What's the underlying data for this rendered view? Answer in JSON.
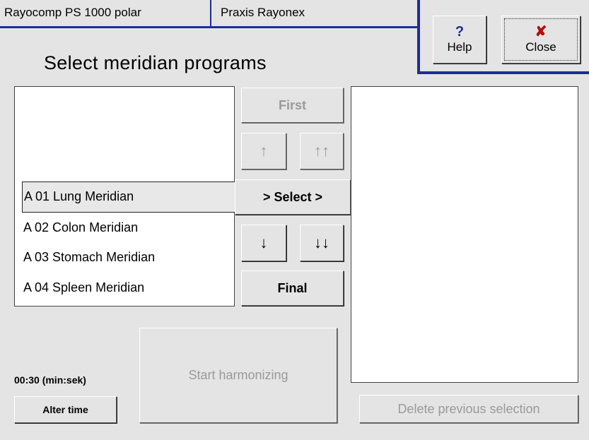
{
  "header": {
    "device_name": "Rayocomp PS 1000 polar",
    "practice_name": "Praxis Rayonex",
    "help_label": "Help",
    "close_label": "Close"
  },
  "page_title": "Select meridian programs",
  "left_list": {
    "items": [
      {
        "label": "A 01 Lung Meridian",
        "selected": true
      },
      {
        "label": "A 02 Colon Meridian",
        "selected": false
      },
      {
        "label": "A 03 Stomach Meridian",
        "selected": false
      },
      {
        "label": "A 04 Spleen Meridian",
        "selected": false
      }
    ]
  },
  "nav_buttons": {
    "first": "First",
    "select": "> Select >",
    "final": "Final",
    "up_icon": "↑",
    "page_up_icon": "↑↑",
    "down_icon": "↓",
    "page_down_icon": "↓↓"
  },
  "bottom": {
    "time_display": "00:30 (min:sek)",
    "alter_time": "Alter time",
    "start_harmonizing": "Start harmonizing",
    "delete_previous": "Delete previous selection"
  },
  "colors": {
    "accent_border": "#1f2c9a",
    "help_icon": "#1f2c9a",
    "close_icon": "#b01010"
  }
}
